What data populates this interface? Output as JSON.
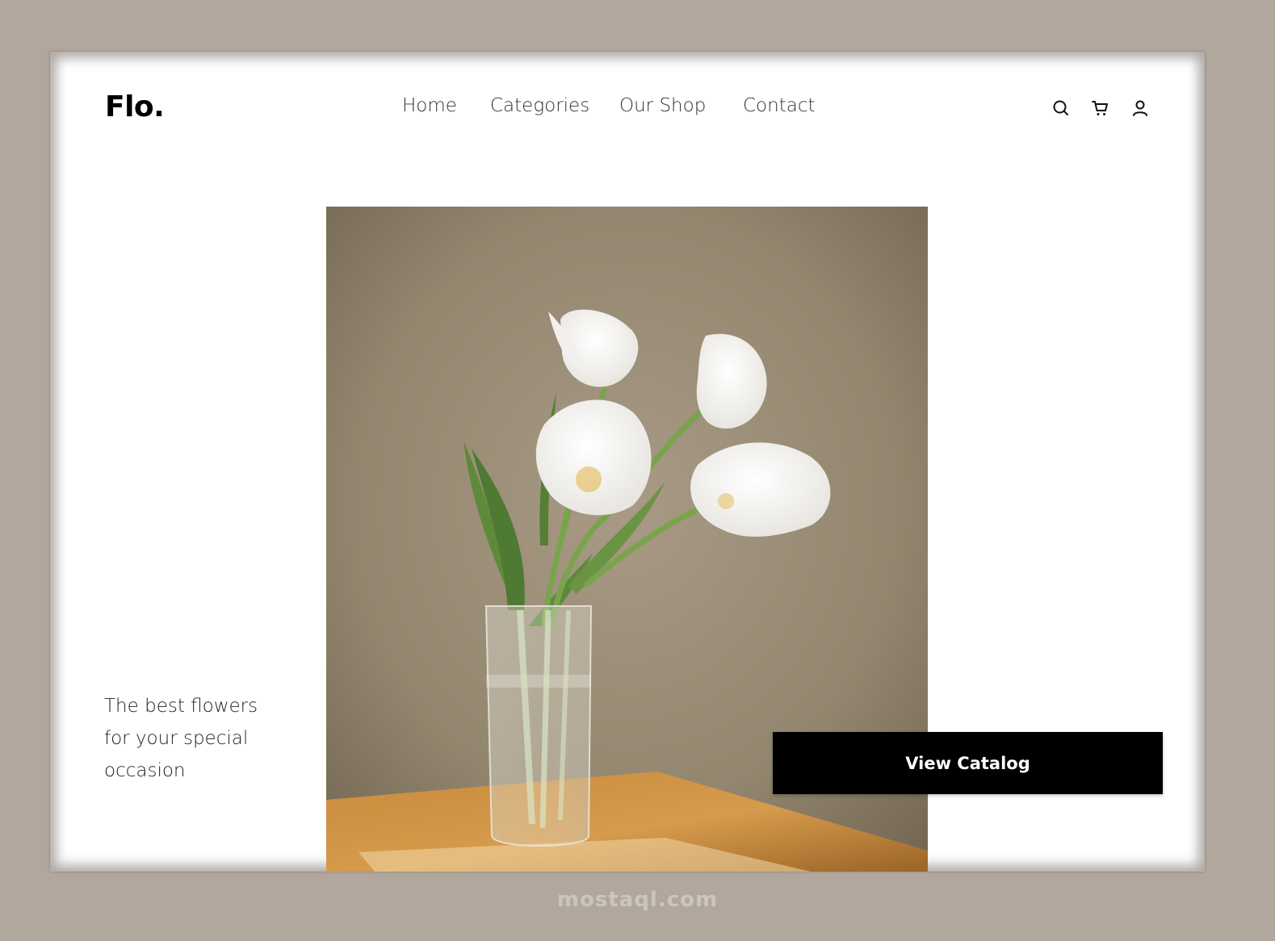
{
  "brand": {
    "logo": "Flo."
  },
  "nav": {
    "items": [
      {
        "label": "Home"
      },
      {
        "label": "Categories"
      },
      {
        "label": "Our Shop"
      },
      {
        "label": "Contact"
      }
    ]
  },
  "header_icons": [
    "search-icon",
    "cart-icon",
    "user-icon"
  ],
  "hero": {
    "tagline_lines": [
      "The best flowers",
      "for your special",
      "occasion"
    ],
    "cta_label": "View Catalog"
  },
  "watermark": "mostaql.com",
  "colors": {
    "page_background": "#b1a79c",
    "frame_background": "#ffffff",
    "cta_background": "#000000",
    "cta_text": "#ffffff"
  }
}
